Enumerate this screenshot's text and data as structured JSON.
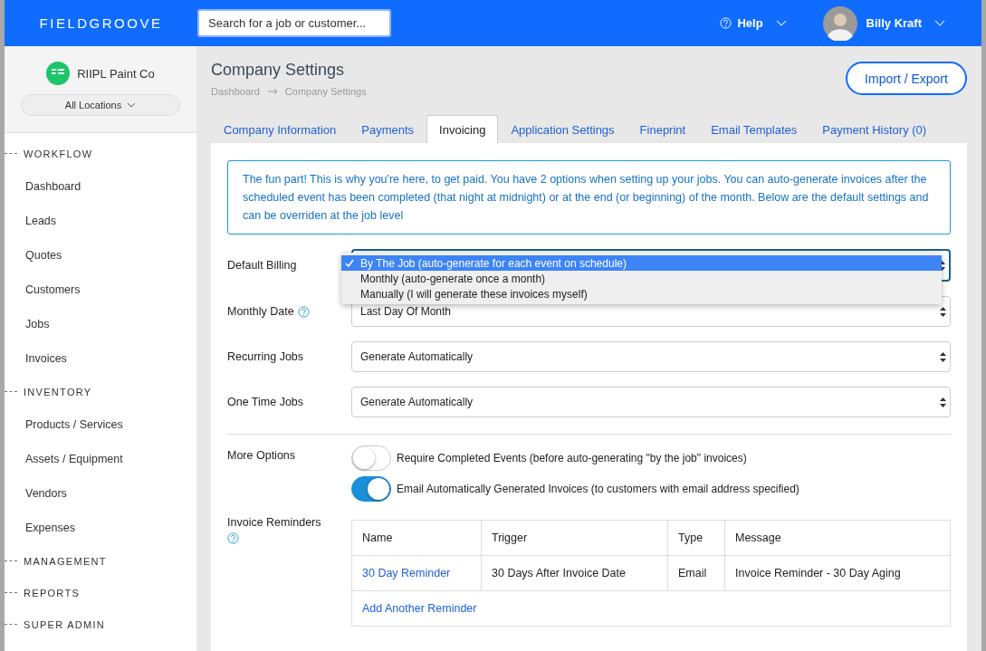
{
  "topbar": {
    "logo": "**FIELD**GROOVE",
    "search": {
      "placeholder": "Search for a job or customer..."
    },
    "help": "Help",
    "user": "Billy Kraft"
  },
  "sidebar": {
    "company": "RIIPL Paint Co",
    "location": "All Locations",
    "sections": [
      {
        "title": "WORKFLOW",
        "items": [
          "Dashboard",
          "Leads",
          "Quotes",
          "Customers",
          "Jobs",
          "Invoices"
        ]
      },
      {
        "title": "INVENTORY",
        "items": [
          "Products / Services",
          "Assets / Equipment",
          "Vendors",
          "Expenses"
        ]
      },
      {
        "title": "MANAGEMENT"
      },
      {
        "title": "REPORTS"
      },
      {
        "title": "SUPER ADMIN"
      }
    ]
  },
  "page": {
    "title": "Company Settings",
    "breadcrumb": [
      "Dashboard",
      "Company Settings"
    ],
    "action": "Import / Export"
  },
  "tabs": [
    {
      "label": "Company Information",
      "selected": false
    },
    {
      "label": "Payments",
      "selected": false
    },
    {
      "label": "Invoicing",
      "selected": true
    },
    {
      "label": "Application Settings",
      "selected": false
    },
    {
      "label": "Fineprint",
      "selected": false
    },
    {
      "label": "Email Templates",
      "selected": false
    },
    {
      "label": "Payment History (0)",
      "selected": false
    }
  ],
  "info": "The fun part! This is why you're here, to get paid. You have 2 options when setting up your jobs. You can auto-generate invoices after the scheduled event has been completed (that night at midnight) or at the end (or beginning) of the month. Below are the default settings and can be overriden at the job level",
  "fields": [
    {
      "kind": "open-select",
      "label": "Default Billing",
      "help": false,
      "options": [
        {
          "label": "By The Job (auto-generate for each event on schedule)",
          "selected": true
        },
        {
          "label": "Monthly (auto-generate once a month)",
          "selected": false
        },
        {
          "label": "Manually (I will generate these invoices myself)",
          "selected": false
        }
      ]
    },
    {
      "kind": "select",
      "label": "Monthly Date",
      "help": true,
      "value": "Last Day Of Month"
    },
    {
      "kind": "select",
      "label": "Recurring Jobs",
      "help": false,
      "value": "Generate Automatically"
    },
    {
      "kind": "select",
      "label": "One Time Jobs",
      "help": false,
      "value": "Generate Automatically"
    }
  ],
  "more_options": {
    "label": "More Options",
    "toggles": [
      {
        "label": "Require Completed Events (before auto-generating \"by the job\" invoices)",
        "on": false
      },
      {
        "label": "Email Automatically Generated Invoices (to customers with email address specified)",
        "on": true
      }
    ]
  },
  "reminders": {
    "label": "Invoice Reminders",
    "help": true,
    "columns": [
      "Name",
      "Trigger",
      "Type",
      "Message"
    ],
    "rows": [
      {
        "cells": [
          "30 Day Reminder",
          "30 Days After Invoice Date",
          "Email",
          "Invoice Reminder - 30 Day Aging"
        ]
      }
    ],
    "add": "Add Another Reminder"
  }
}
